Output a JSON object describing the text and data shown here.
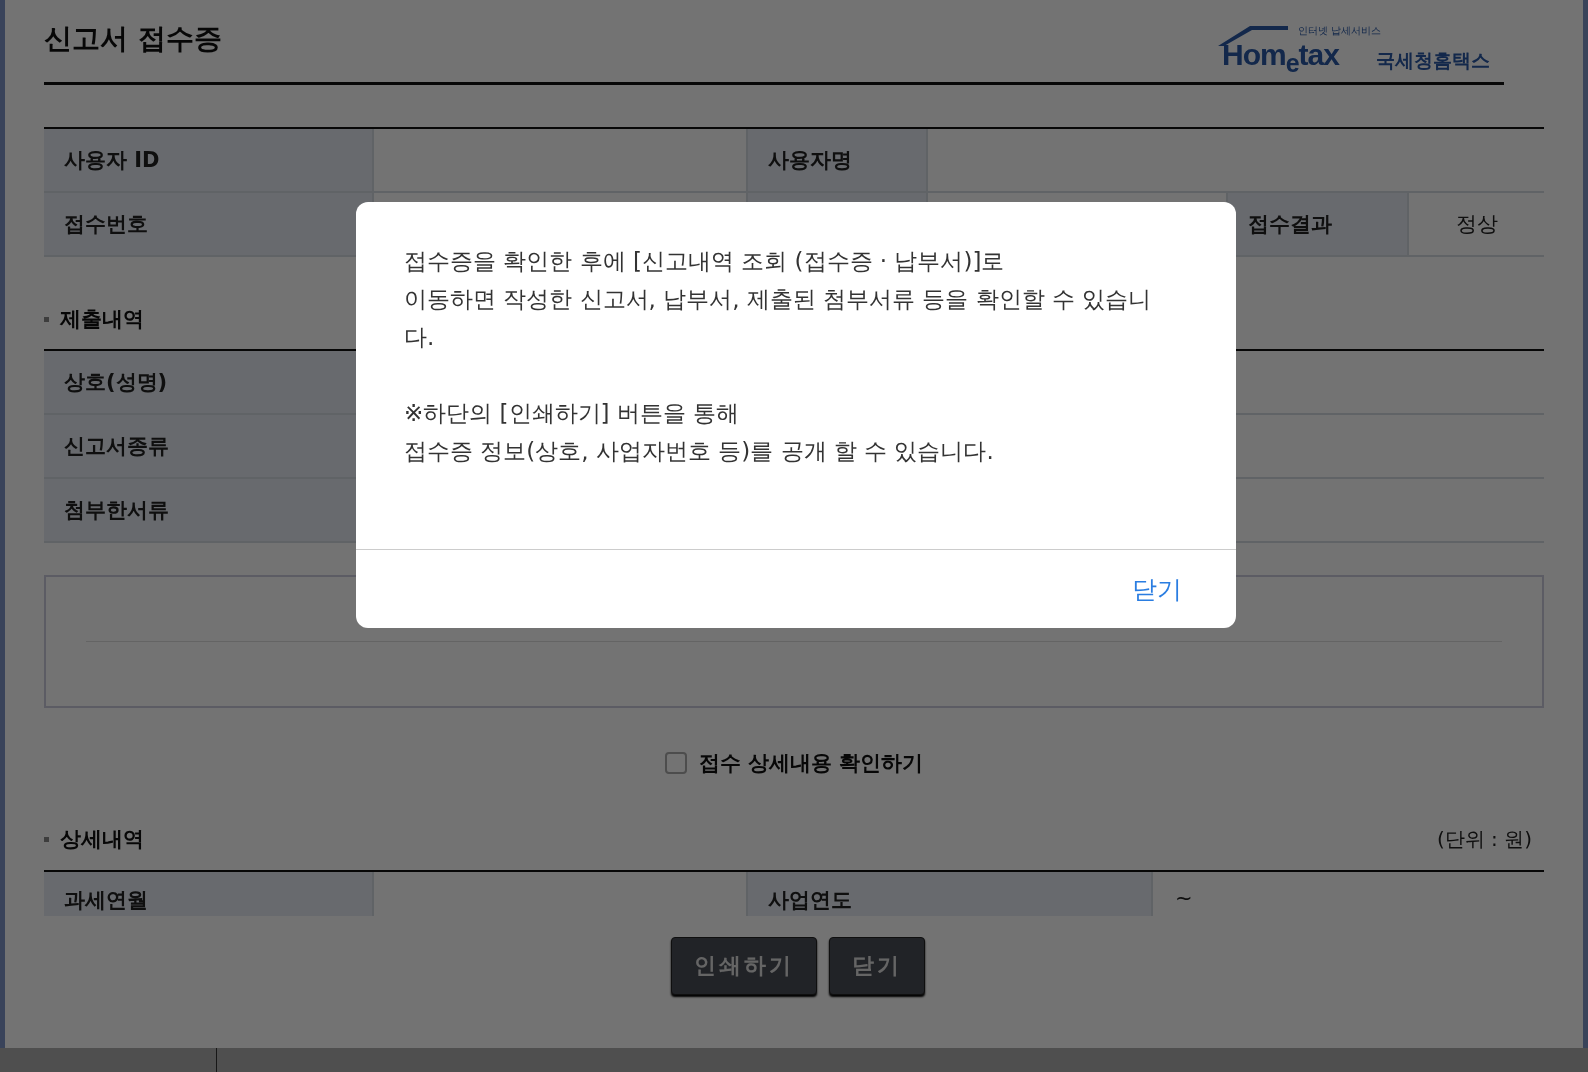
{
  "header": {
    "title": "신고서 접수증",
    "logo": {
      "tagline": "인터넷 납세서비스",
      "wordmark": "Hom$_{e}$tax",
      "name": "국세청홈택스"
    }
  },
  "user_table": {
    "rows": [
      [
        {
          "kind": "label",
          "text": "사용자 ID"
        },
        {
          "kind": "value"
        },
        {
          "kind": "label",
          "text": "사용자명"
        },
        {
          "kind": "value"
        }
      ],
      [
        {
          "kind": "label",
          "text": "접수번호"
        },
        {
          "kind": "value"
        },
        {
          "kind": "label"
        },
        {
          "kind": "value"
        },
        {
          "kind": "label",
          "text": "접수결과"
        },
        {
          "kind": "value",
          "text": "정상"
        }
      ]
    ]
  },
  "submission": {
    "heading": "제출내역",
    "rows": [
      {
        "label": "상호(성명)"
      },
      {
        "label": "신고서종류"
      },
      {
        "label": "첨부한서류"
      }
    ]
  },
  "detail_check": {
    "label": "접수 상세내용 확인하기",
    "checked": false
  },
  "details": {
    "heading": "상세내역",
    "unit": "(단위 : 원)",
    "rows": [
      [
        {
          "kind": "label",
          "text": "과세연월"
        },
        {
          "kind": "value"
        },
        {
          "kind": "label",
          "text": "사업연도"
        },
        {
          "kind": "value",
          "text": "~"
        }
      ]
    ]
  },
  "buttons": [
    {
      "label": "인쇄하기"
    },
    {
      "label": "닫기"
    }
  ],
  "dialog": {
    "paragraphs": [
      [
        "접수증을 확인한 후에 [신고내역 조회 (접수증 · 납부서)]로",
        "이동하면 작성한 신고서, 납부서, 제출된 첨부서류 등을 확인할 수 있습니다."
      ],
      [
        "※하단의 [인쇄하기] 버튼을 통해",
        "접수증 정보(상호, 사업자번호 등)를 공개 할 수 있습니다."
      ]
    ],
    "close": "닫기"
  }
}
